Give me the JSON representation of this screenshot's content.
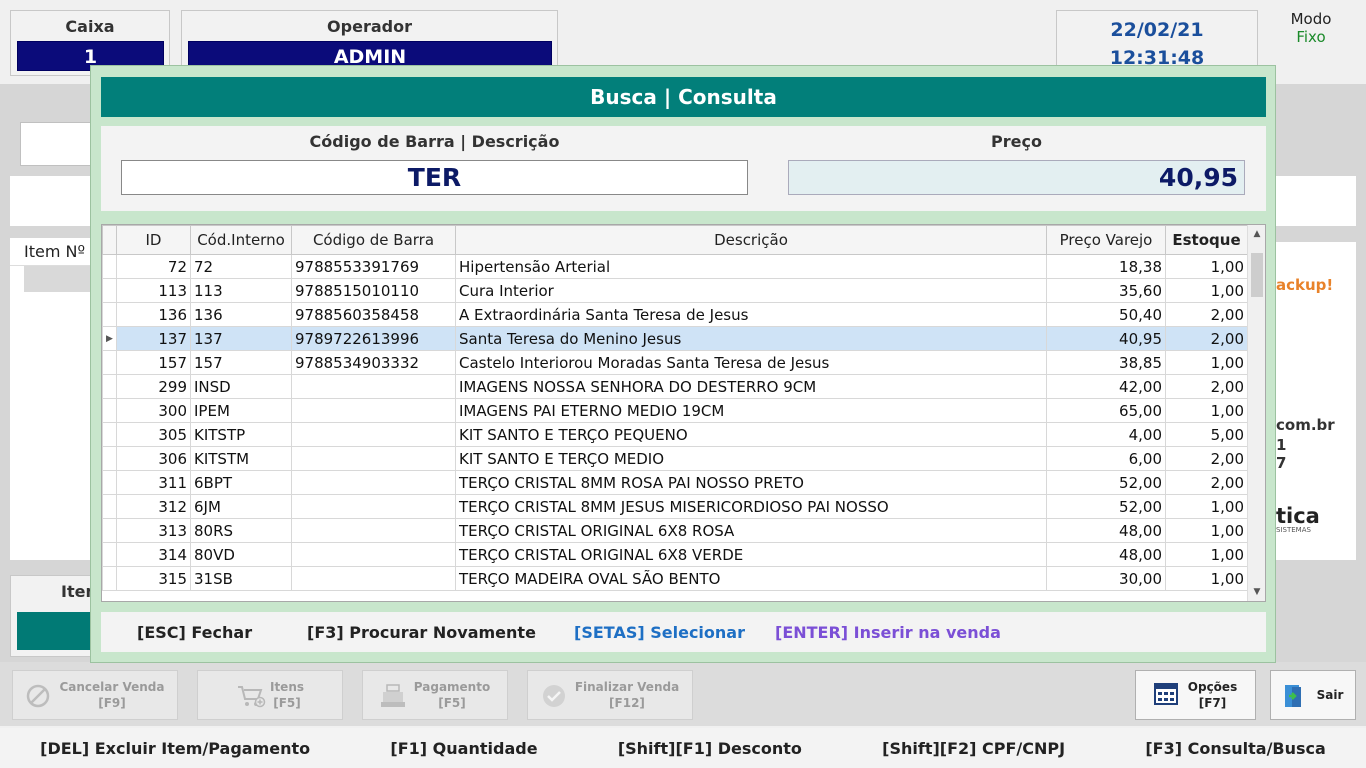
{
  "caixa": {
    "label": "Caixa",
    "value": "1"
  },
  "operador": {
    "label": "Operador",
    "value": "ADMIN"
  },
  "datetime": {
    "date": "22/02/21",
    "time": "12:31:48"
  },
  "modo": {
    "label": "Modo",
    "value": "Fixo"
  },
  "background": {
    "item_header": "Item Nº",
    "bottom_label": "Item",
    "side_texts": [
      "ackup!",
      "com.br",
      "1",
      "7",
      "tica",
      "SISTEMAS"
    ]
  },
  "modal": {
    "title": "Busca | Consulta",
    "search_label": "Código de Barra | Descrição",
    "search_value": "TER",
    "price_label": "Preço",
    "price_value": "40,95",
    "columns": [
      "ID",
      "Cód.Interno",
      "Código de Barra",
      "Descrição",
      "Preço Varejo",
      "Estoque"
    ],
    "rows": [
      [
        "72",
        "72",
        "9788553391769",
        "Hipertensão Arterial",
        "18,38",
        "1,00"
      ],
      [
        "113",
        "113",
        "9788515010110",
        "Cura Interior",
        "35,60",
        "1,00"
      ],
      [
        "136",
        "136",
        "9788560358458",
        "A Extraordinária Santa Teresa de Jesus",
        "50,40",
        "2,00"
      ],
      [
        "137",
        "137",
        "9789722613996",
        "Santa Teresa do Menino Jesus",
        "40,95",
        "2,00"
      ],
      [
        "157",
        "157",
        "9788534903332",
        "Castelo Interiorou Moradas Santa Teresa de Jesus",
        "38,85",
        "1,00"
      ],
      [
        "299",
        "INSD",
        "",
        "IMAGENS NOSSA SENHORA DO DESTERRO 9CM",
        "42,00",
        "2,00"
      ],
      [
        "300",
        "IPEM",
        "",
        "IMAGENS PAI ETERNO MEDIO 19CM",
        "65,00",
        "1,00"
      ],
      [
        "305",
        "KITSTP",
        "",
        "KIT SANTO E TERÇO PEQUENO",
        "4,00",
        "5,00"
      ],
      [
        "306",
        "KITSTM",
        "",
        "KIT SANTO E TERÇO MEDIO",
        "6,00",
        "2,00"
      ],
      [
        "311",
        "6BPT",
        "",
        "TERÇO CRISTAL 8MM ROSA PAI NOSSO PRETO",
        "52,00",
        "2,00"
      ],
      [
        "312",
        "6JM",
        "",
        "TERÇO CRISTAL 8MM JESUS MISERICORDIOSO PAI NOSSO",
        "52,00",
        "1,00"
      ],
      [
        "313",
        "80RS",
        "",
        "TERÇO CRISTAL ORIGINAL 6X8 ROSA",
        "48,00",
        "1,00"
      ],
      [
        "314",
        "80VD",
        "",
        "TERÇO CRISTAL ORIGINAL 6X8 VERDE",
        "48,00",
        "1,00"
      ],
      [
        "315",
        "31SB",
        "",
        "TERÇO MADEIRA OVAL SÃO BENTO",
        "30,00",
        "1,00"
      ]
    ],
    "selected_row": 3,
    "hints": {
      "esc": "[ESC] Fechar",
      "f3": "[F3] Procurar Novamente",
      "setas": "[SETAS] Selecionar",
      "enter": "[ENTER] Inserir na venda"
    },
    "colors": {
      "header": "#027f7a",
      "setas": "#1e6fc4",
      "enter": "#7b4fd6"
    }
  },
  "toolbar": {
    "cancelar": {
      "label": "Cancelar Venda",
      "key": "[F9]"
    },
    "itens": {
      "label": "Itens",
      "key": "[F5]"
    },
    "pagamento": {
      "label": "Pagamento",
      "key": "[F5]"
    },
    "finalizar": {
      "label": "Finalizar Venda",
      "key": "[F12]"
    },
    "opcoes": {
      "label": "Opções",
      "key": "[F7]"
    },
    "sair": {
      "label": "Sair"
    }
  },
  "shortcuts": [
    "[DEL] Excluir Item/Pagamento",
    "[F1] Quantidade",
    "[Shift][F1] Desconto",
    "[Shift][F2] CPF/CNPJ",
    "[F3] Consulta/Busca"
  ]
}
